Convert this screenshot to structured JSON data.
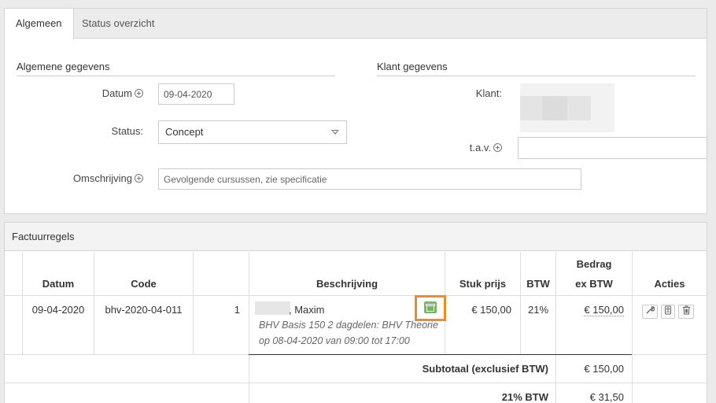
{
  "tabs": [
    {
      "label": "Algemeen",
      "active": true
    },
    {
      "label": "Status overzicht",
      "active": false
    }
  ],
  "general": {
    "title": "Algemene gegevens",
    "datum_label": "Datum",
    "datum_value": "09-04-2020",
    "status_label": "Status:",
    "status_value": "Concept",
    "omschrijving_label": "Omschrijving",
    "omschrijving_placeholder": "Gevolgende cursussen, zie specificatie"
  },
  "client": {
    "title": "Klant gegevens",
    "klant_label": "Klant:",
    "tav_label": "t.a.v."
  },
  "invoice_lines": {
    "title": "Factuurregels",
    "headers": {
      "datum": "Datum",
      "code": "Code",
      "beschrijving": "Beschrijving",
      "stuk_prijs": "Stuk prijs",
      "btw": "BTW",
      "bedrag_line1": "Bedrag",
      "bedrag_line2": "ex BTW",
      "acties": "Acties"
    },
    "rows": [
      {
        "datum": "09-04-2020",
        "code": "bhv-2020-04-011",
        "aantal": "1",
        "naam": ", Maxim",
        "omschrijving_1": "BHV Basis 150 2 dagdelen: BHV Theorie",
        "omschrijving_2": "op 08-04-2020 van 09:00 tot 17:00",
        "stuk_prijs": "€ 150,00",
        "btw": "21%",
        "bedrag": "€ 150,00"
      }
    ],
    "subtotal_label": "Subtotaal (exclusief BTW)",
    "subtotal_value": "€ 150,00",
    "vat_label": "21% BTW",
    "vat_value": "€ 31,50"
  },
  "icons": {
    "gift": "gift-icon",
    "edit": "wrench-icon",
    "person": "person-icon",
    "delete": "trash-icon",
    "plus": "plus-circle-icon"
  },
  "colors": {
    "highlight": "#f08a24",
    "gift": "#72b95c"
  }
}
